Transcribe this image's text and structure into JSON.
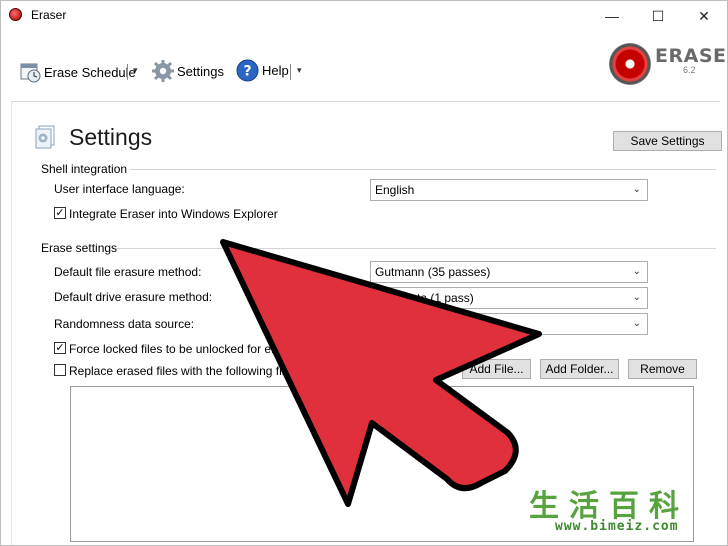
{
  "window": {
    "title": "Eraser",
    "minimize": "—",
    "maximize": "☐",
    "close": "✕"
  },
  "toolbar": {
    "erase_schedule": "Erase Schedule",
    "settings": "Settings",
    "help": "Help",
    "dropdown_glyph": "▾"
  },
  "brand": {
    "name": "ERASER",
    "version": "6.2"
  },
  "page": {
    "title": "Settings",
    "save_button": "Save Settings"
  },
  "shell": {
    "heading": "Shell integration",
    "language_label": "User interface language:",
    "language_value": "English",
    "integrate_label": "Integrate Eraser into Windows Explorer",
    "integrate_checked": "✓"
  },
  "erase": {
    "heading": "Erase settings",
    "file_method_label": "Default file erasure method:",
    "file_method_value": "Gutmann (35 passes)",
    "drive_method_label": "Default drive erasure method:",
    "drive_method_value": "dom Data (1 pass)",
    "random_label": "Randomness data source:",
    "random_value": "r",
    "force_label": "Force locked files to be unlocked for era",
    "force_checked": "✓",
    "replace_label": "Replace erased files with the following file",
    "replace_suffix": "y",
    "add_file": "Add File...",
    "add_folder": "Add Folder...",
    "remove": "Remove",
    "chevron": "⌄"
  },
  "overlay": {
    "arrow_color": "#e0303c",
    "arrow_outline": "#000000"
  },
  "watermark": {
    "chars": "生活百科",
    "url": "www.bimeiz.com"
  }
}
